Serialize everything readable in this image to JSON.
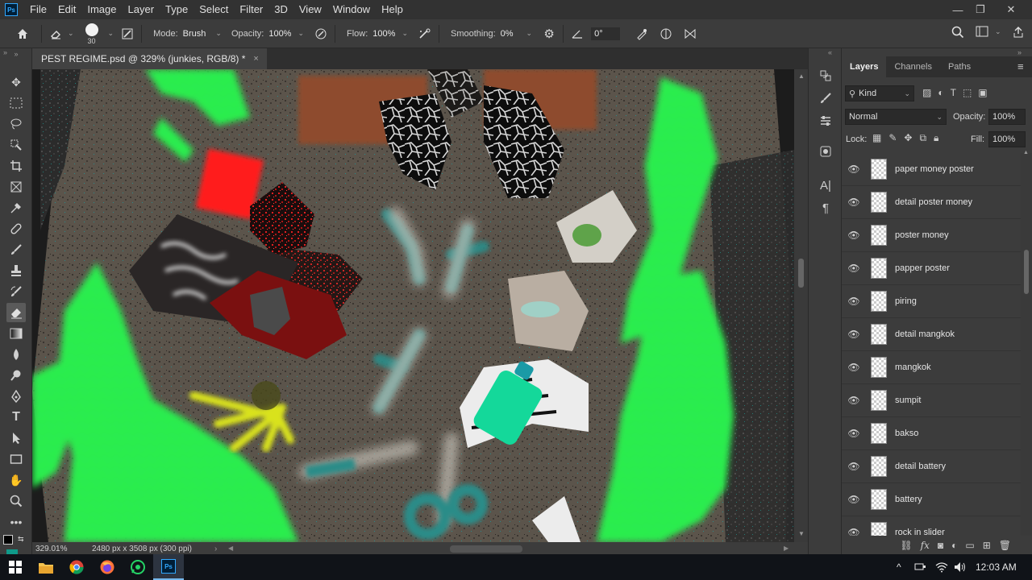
{
  "menubar": {
    "app_badge": "Ps",
    "items": [
      "File",
      "Edit",
      "Image",
      "Layer",
      "Type",
      "Select",
      "Filter",
      "3D",
      "View",
      "Window",
      "Help"
    ],
    "controls": {
      "minimize": "—",
      "restore": "❐",
      "close": "✕"
    }
  },
  "options": {
    "brush_size": "30",
    "mode_label": "Mode:",
    "mode_value": "Brush",
    "opacity_label": "Opacity:",
    "opacity_value": "100%",
    "flow_label": "Flow:",
    "flow_value": "100%",
    "smoothing_label": "Smoothing:",
    "smoothing_value": "0%",
    "angle_value": "0°"
  },
  "document": {
    "tab_title": "PEST REGIME.psd @ 329% (junkies, RGB/8) *",
    "close": "×"
  },
  "status": {
    "zoom": "329.01%",
    "doc_info": "2480 px x 3508 px (300 ppi)",
    "arrow": "›"
  },
  "layers_panel": {
    "tabs": [
      "Layers",
      "Channels",
      "Paths"
    ],
    "kind_label": "Kind",
    "blend_mode": "Normal",
    "opacity_label": "Opacity:",
    "opacity_value": "100%",
    "lock_label": "Lock:",
    "fill_label": "Fill:",
    "fill_value": "100%",
    "layers": [
      "paper money poster",
      "detail poster money",
      "poster money",
      "papper poster",
      "piring",
      "detail mangkok",
      "mangkok",
      "sumpit",
      "bakso",
      "detail battery",
      "battery",
      "rock in slider"
    ],
    "footer_icons": [
      "link-icon",
      "fx-icon",
      "mask-icon",
      "adjustment-icon",
      "folder-icon",
      "new-layer-icon",
      "trash-icon"
    ]
  },
  "taskbar": {
    "apps": [
      "start",
      "file-explorer",
      "chrome",
      "firefox",
      "whatsapp",
      "photoshop"
    ],
    "time": "12:03 AM",
    "tray_caret": "^"
  },
  "colors": {
    "neon_green": "#22ee44",
    "canvas_bg": "#5b544b",
    "accent": "#31a8ff"
  }
}
